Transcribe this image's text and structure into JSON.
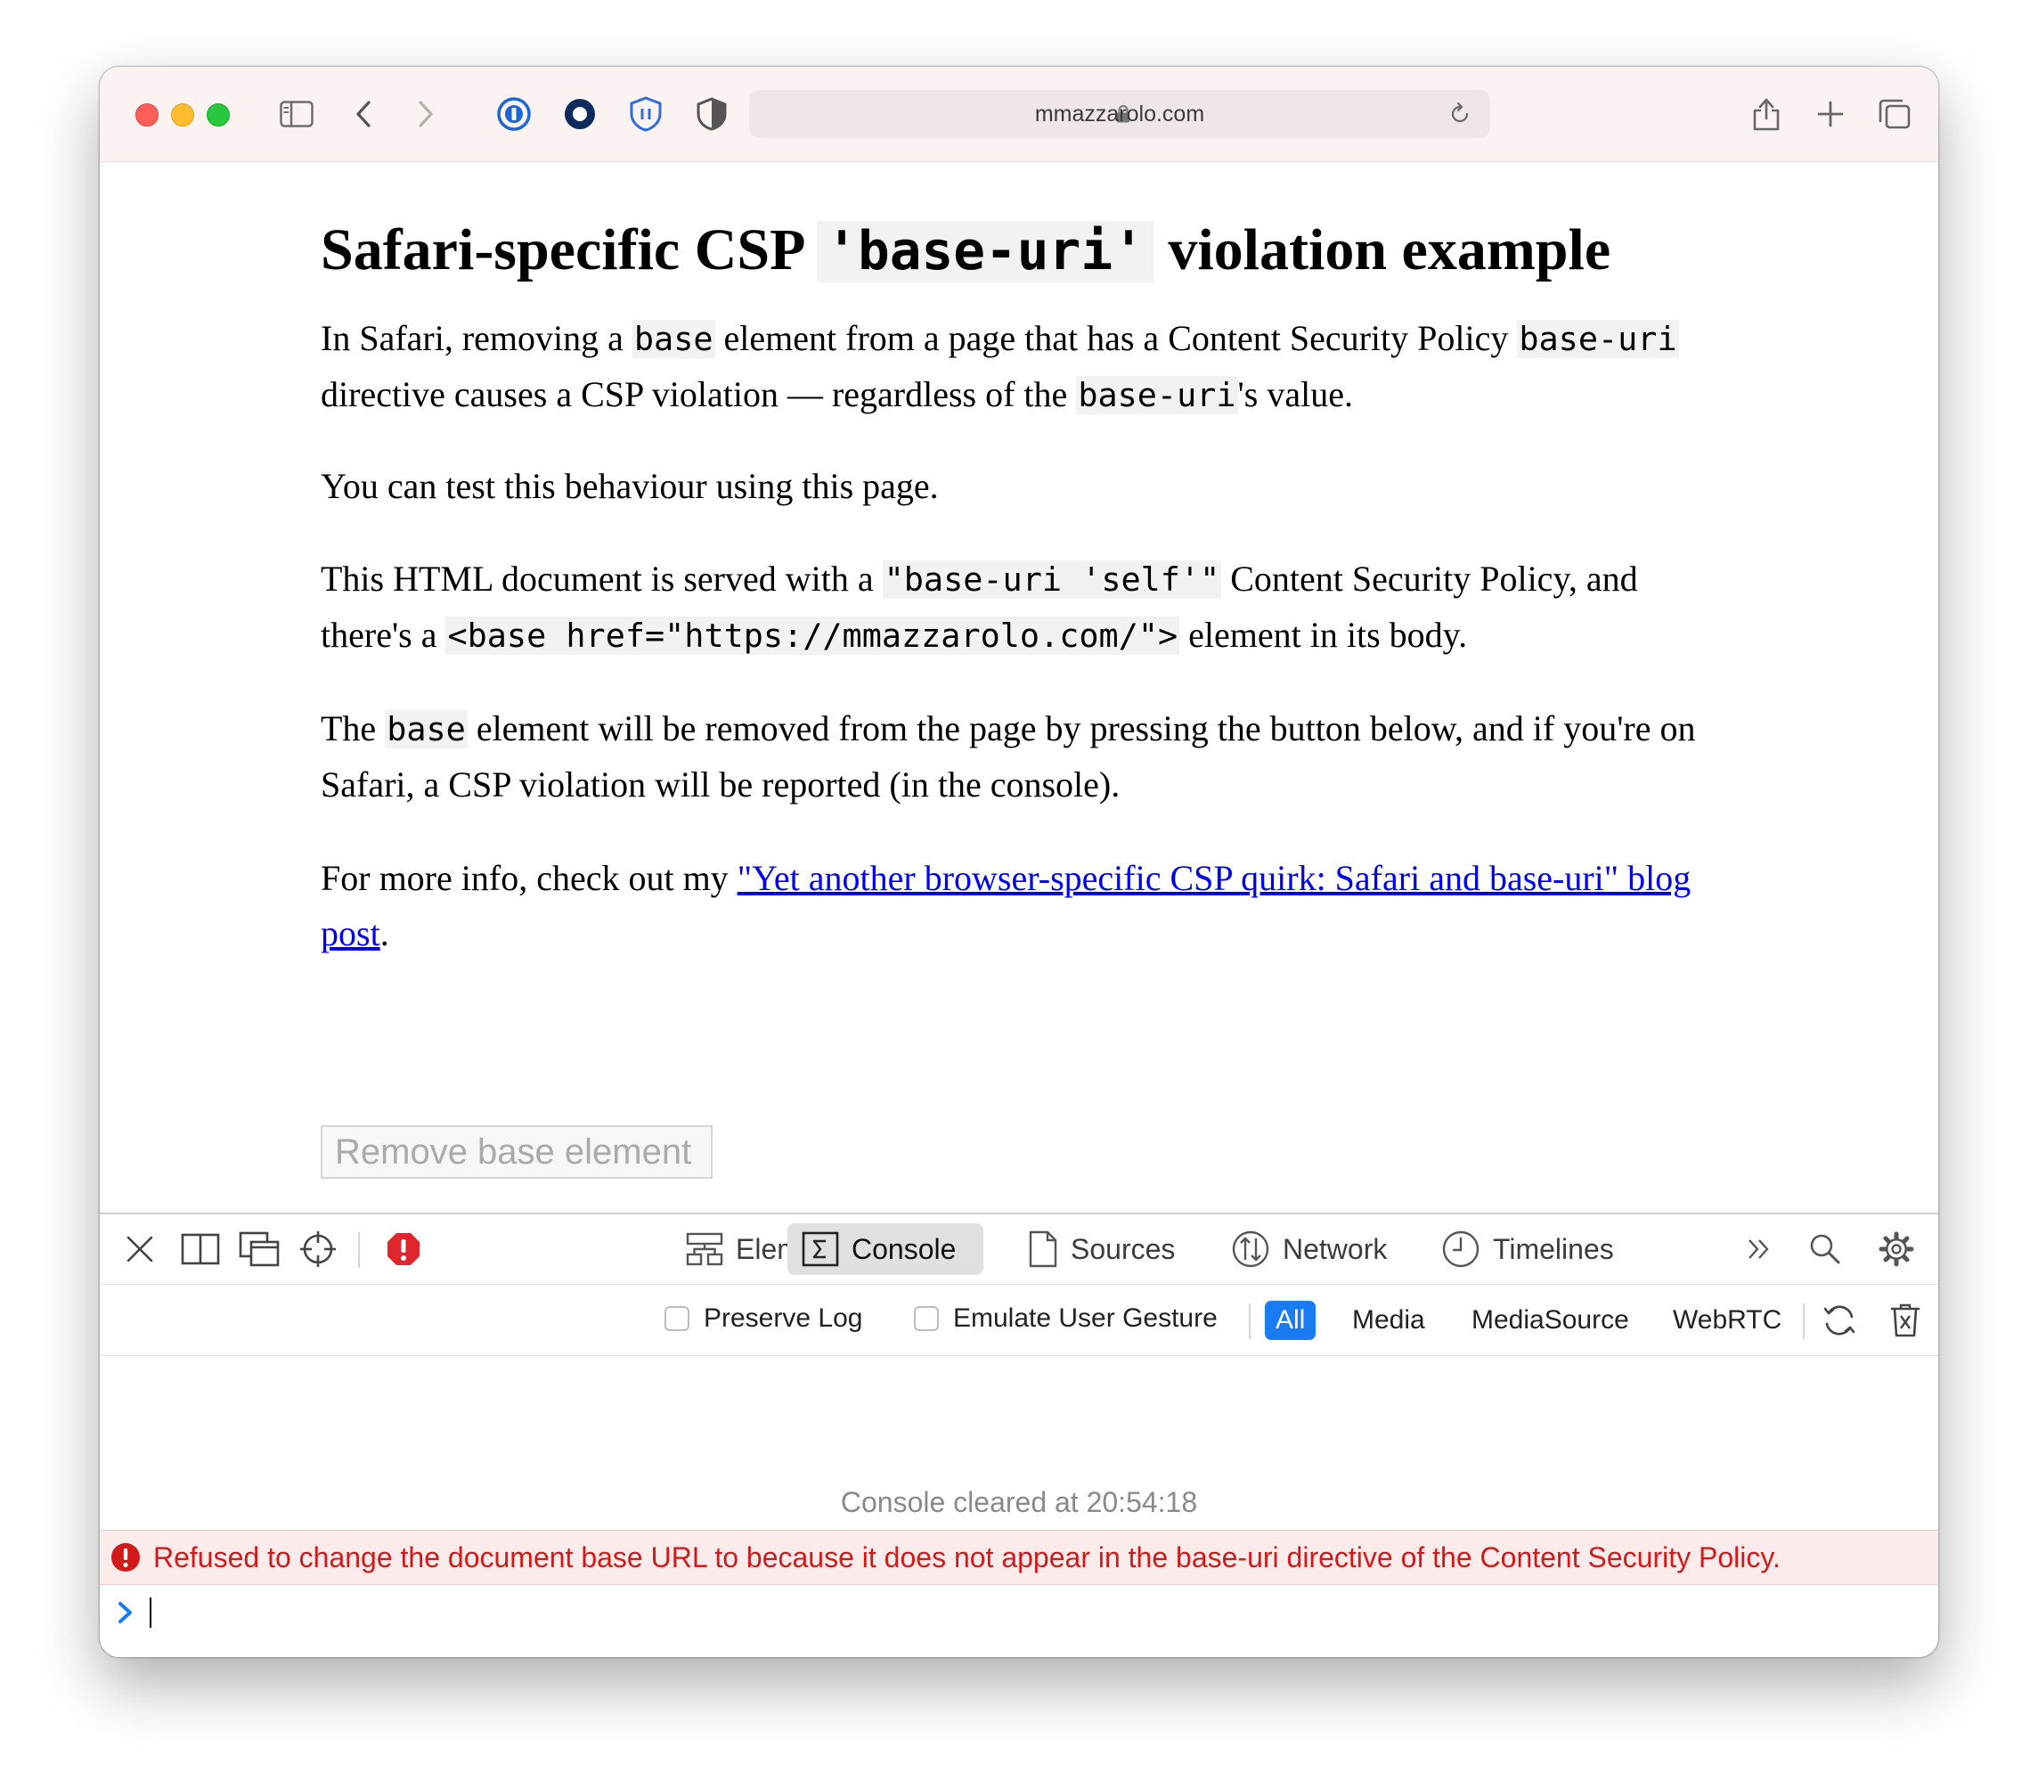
{
  "browser": {
    "url": "mmazzarolo.com"
  },
  "page": {
    "title_before": "Safari-specific CSP ",
    "title_code": "'base-uri'",
    "title_after": " violation example",
    "p1": {
      "t1": "In Safari, removing a ",
      "c1": "base",
      "t2": " element from a page that has a Content Security Policy ",
      "c2": "base-uri",
      "t3": " directive causes a CSP violation — regardless of the ",
      "c3": "base-uri",
      "t4": "'s value."
    },
    "p2": "You can test this behaviour using this page.",
    "p3": {
      "t1": "This HTML document is served with a ",
      "c1": "\"base-uri 'self'\"",
      "t2": " Content Security Policy, and there's a ",
      "c2": "<base href=\"https://mmazzarolo.com/\">",
      "t3": " element in its body."
    },
    "p4": {
      "t1": "The ",
      "c1": "base",
      "t2": " element will be removed from the page by pressing the button below, and if you're on Safari, a CSP violation will be reported (in the console)."
    },
    "p5": {
      "t1": "For more info, check out my ",
      "link": "\"Yet another browser-specific CSP quirk: Safari and base-uri\" blog post",
      "t2": "."
    },
    "button_label": "Remove base element"
  },
  "devtools": {
    "tabs": [
      {
        "label": "Elements",
        "icon": "elements-icon"
      },
      {
        "label": "Console",
        "icon": "console-icon"
      },
      {
        "label": "Sources",
        "icon": "sources-icon"
      },
      {
        "label": "Network",
        "icon": "network-icon"
      },
      {
        "label": "Timelines",
        "icon": "timelines-icon"
      }
    ],
    "active_tab": "Console",
    "checkboxes": [
      {
        "label": "Preserve Log",
        "checked": false
      },
      {
        "label": "Emulate User Gesture",
        "checked": false
      }
    ],
    "filters": [
      "All",
      "Media",
      "MediaSource",
      "WebRTC"
    ],
    "active_filter": "All",
    "cleared_message": "Console cleared at 20:54:18",
    "error_message": "Refused to change the document base URL to because it does not appear in the base-uri directive of the Content Security Policy.",
    "colors": {
      "accent": "#1a7cf5",
      "error_text": "#d11a1a",
      "error_bg": "#fcebeb",
      "link": "#0000ee"
    }
  }
}
